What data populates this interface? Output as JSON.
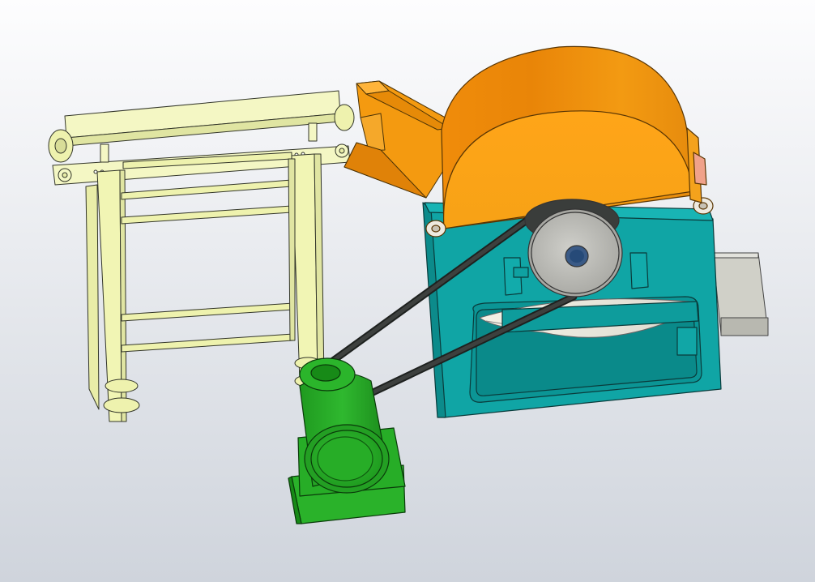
{
  "scene": {
    "view_type": "3D CAD assembly view",
    "background": {
      "top": "#fdfdfe",
      "bottom": "#cfd4dc"
    },
    "components": [
      {
        "id": "conveyor-frame",
        "color": "#f1f5b4"
      },
      {
        "id": "feed-hopper",
        "color": "#f49a10"
      },
      {
        "id": "cutter-housing",
        "color": "#f59a0c"
      },
      {
        "id": "base-frame",
        "color": "#0fa3a3"
      },
      {
        "id": "driven-pulley",
        "color": "#b9b9b4"
      },
      {
        "id": "drive-belt",
        "color": "#2d302f"
      },
      {
        "id": "electric-motor",
        "color": "#22a822"
      },
      {
        "id": "discharge-chute",
        "color": "#c9c9c2"
      }
    ]
  }
}
